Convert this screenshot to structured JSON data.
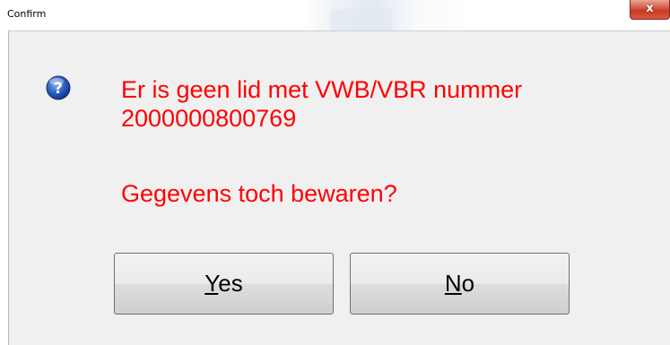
{
  "window": {
    "title": "Confirm",
    "close_label": "x"
  },
  "dialog": {
    "icon": "question-icon",
    "message_line1": "Er is geen lid met VWB/VBR nummer",
    "message_line2": "2000000800769",
    "message_line3": "Gegevens toch bewaren?",
    "message_color": "#ff0000"
  },
  "buttons": {
    "yes": {
      "mnemonic": "Y",
      "rest": "es"
    },
    "no": {
      "mnemonic": "N",
      "rest": "o"
    }
  }
}
